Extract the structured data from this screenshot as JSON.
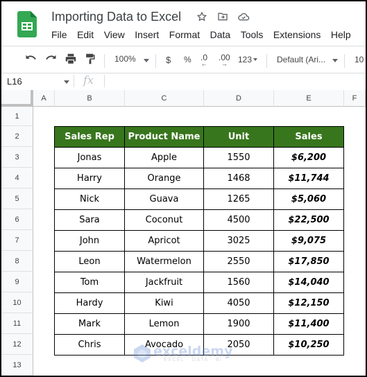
{
  "app": {
    "doc_title": "Importing Data to Excel",
    "title_icons": [
      "star-icon",
      "move-to-folder-icon",
      "cloud-saved-icon"
    ],
    "brand_color": "#34a853"
  },
  "menu": [
    "File",
    "Edit",
    "View",
    "Insert",
    "Format",
    "Data",
    "Tools",
    "Extensions",
    "Help"
  ],
  "toolbar": {
    "zoom": "100%",
    "currency": "$",
    "percent": "%",
    "decrease_decimal": ".0",
    "increase_decimal": ".00",
    "more_formats": "123",
    "font": "Default (Ari...",
    "font_size": "10"
  },
  "formula_bar": {
    "name_box": "L16",
    "fx": "fx",
    "value": ""
  },
  "grid": {
    "columns": [
      "A",
      "B",
      "C",
      "D",
      "E",
      "F"
    ],
    "rows": [
      "1",
      "2",
      "3",
      "4",
      "5",
      "6",
      "7",
      "8",
      "9",
      "10",
      "11",
      "12",
      "13"
    ]
  },
  "table": {
    "header_color": "#38761d",
    "headers": [
      "Sales Rep",
      "Product Name",
      "Unit",
      "Sales"
    ],
    "rows": [
      [
        "Jonas",
        "Apple",
        "1550",
        "$6,200"
      ],
      [
        "Harry",
        "Orange",
        "1468",
        "$11,744"
      ],
      [
        "Nick",
        "Guava",
        "1265",
        "$5,060"
      ],
      [
        "Sara",
        "Coconut",
        "4500",
        "$22,500"
      ],
      [
        "John",
        "Apricot",
        "3025",
        "$9,075"
      ],
      [
        "Leon",
        "Watermelon",
        "2550",
        "$17,850"
      ],
      [
        "Tom",
        "Jackfruit",
        "1560",
        "$14,040"
      ],
      [
        "Hardy",
        "Kiwi",
        "4050",
        "$12,150"
      ],
      [
        "Mark",
        "Lemon",
        "1900",
        "$11,400"
      ],
      [
        "Chris",
        "Avocado",
        "2050",
        "$10,250"
      ]
    ]
  },
  "watermark": {
    "name": "exceldemy",
    "tagline": "EXCEL · DATA · BI"
  }
}
